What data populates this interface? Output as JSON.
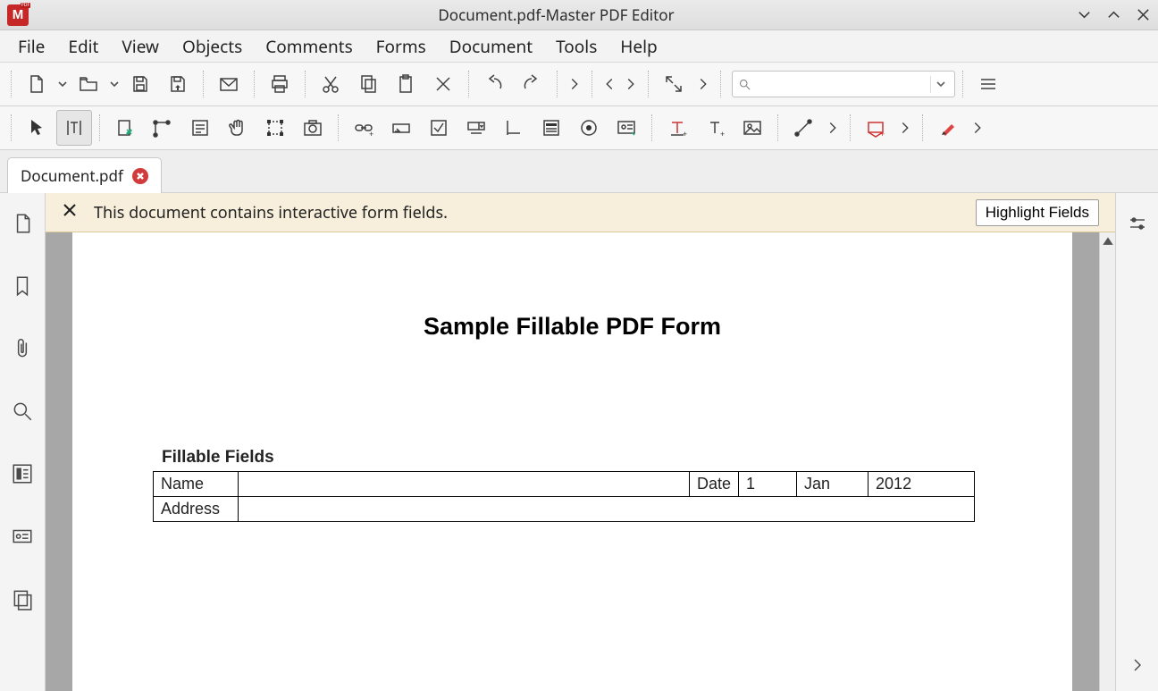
{
  "window": {
    "title": "Document.pdf-Master PDF Editor"
  },
  "menu": [
    "File",
    "Edit",
    "View",
    "Objects",
    "Comments",
    "Forms",
    "Document",
    "Tools",
    "Help"
  ],
  "tab": {
    "label": "Document.pdf"
  },
  "infobar": {
    "text": "This document contains interactive form fields.",
    "button": "Highlight Fields"
  },
  "search": {
    "placeholder": ""
  },
  "pdf": {
    "title": "Sample Fillable PDF Form",
    "section": "Fillable Fields",
    "row1": {
      "name_label": "Name",
      "name_value": "",
      "date_label": "Date",
      "day": "1",
      "month": "Jan",
      "year": "2012"
    },
    "row2": {
      "address_label": "Address",
      "address_value": ""
    }
  }
}
